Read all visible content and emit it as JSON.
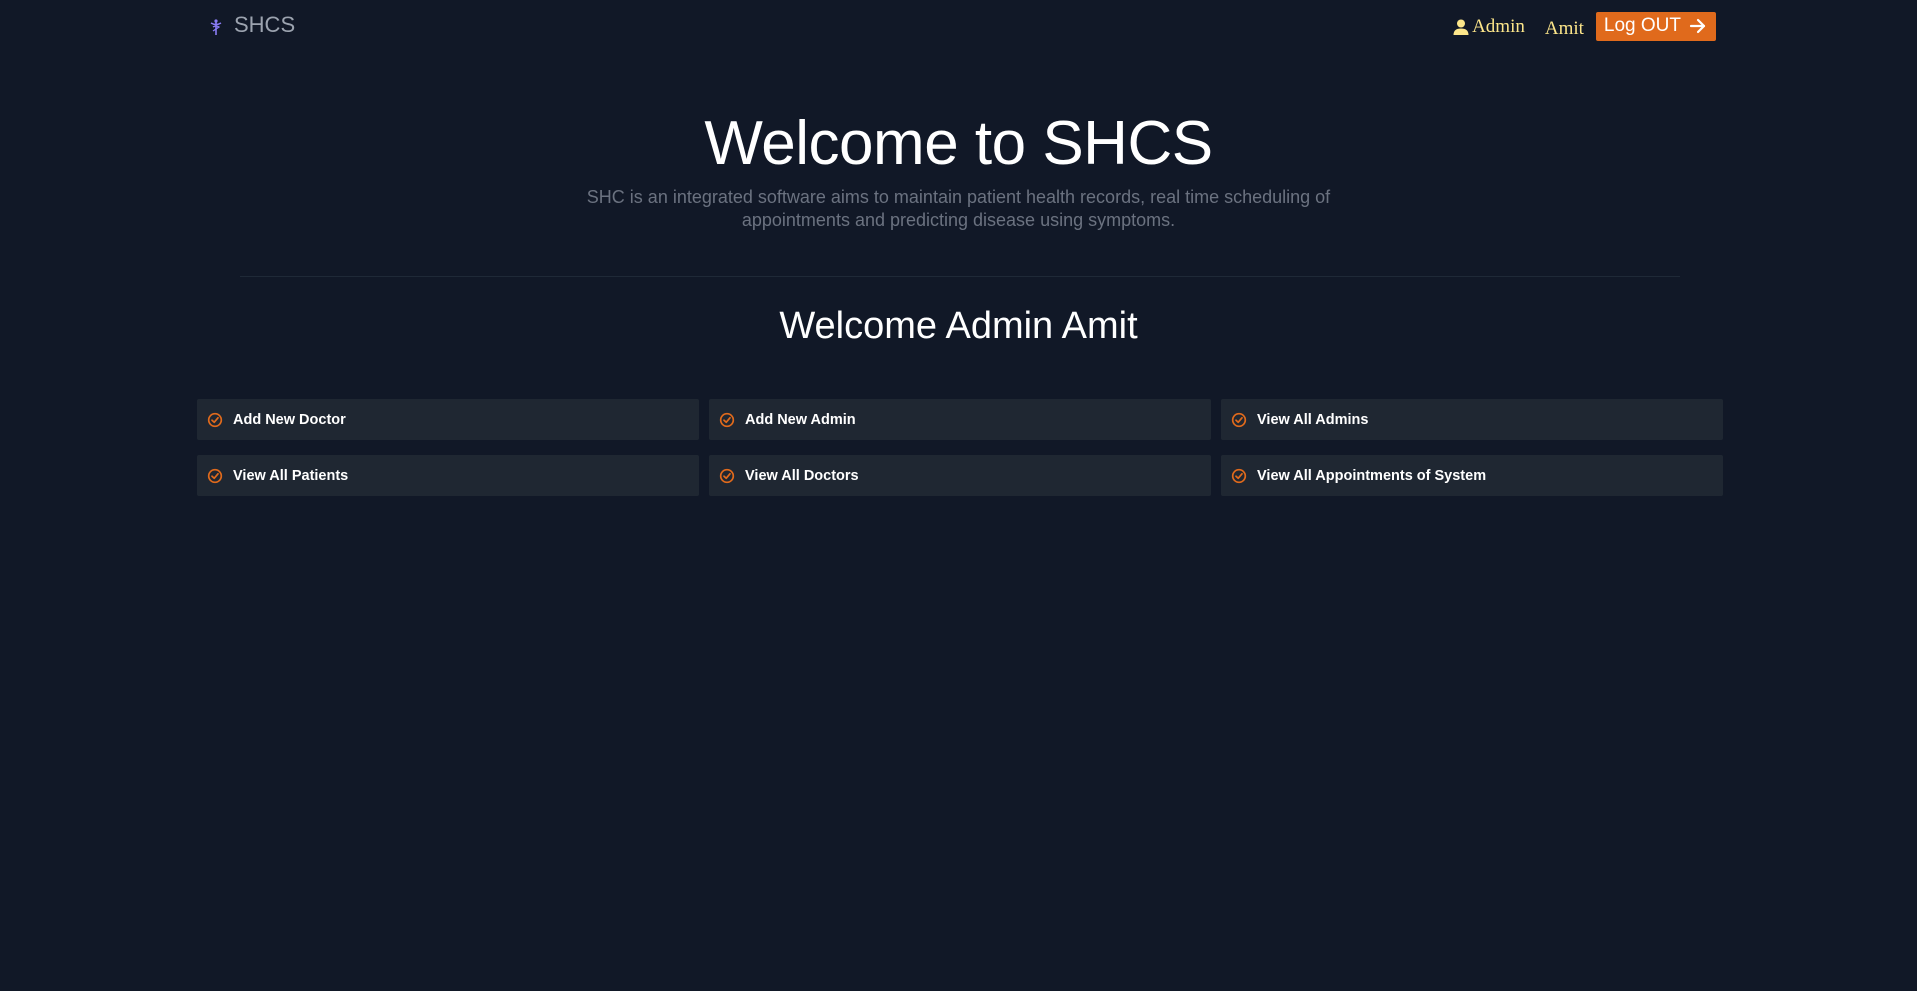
{
  "navbar": {
    "brand": "SHCS",
    "role": "Admin",
    "user_name": "Amit",
    "logout_label": "Log OUT"
  },
  "hero": {
    "title": "Welcome to SHCS",
    "subtitle": "SHC is an integrated software aims to maintain patient health records, real time scheduling of appointments and predicting disease using symptoms."
  },
  "welcome": "Welcome Admin Amit",
  "actions": [
    {
      "label": "Add New Doctor"
    },
    {
      "label": "Add New Admin"
    },
    {
      "label": "View All Admins"
    },
    {
      "label": "View All Patients"
    },
    {
      "label": "View All Doctors"
    },
    {
      "label": "View All Appointments of System"
    }
  ],
  "icons": {
    "brand": "caduceus-icon",
    "user": "user-icon",
    "logout": "arrow-right-icon",
    "action": "check-circle-icon"
  },
  "colors": {
    "background": "#111827",
    "accent": "#e06a1c",
    "tile": "#1f2732",
    "user_text": "#fde68a",
    "subtitle": "#6b7280"
  }
}
